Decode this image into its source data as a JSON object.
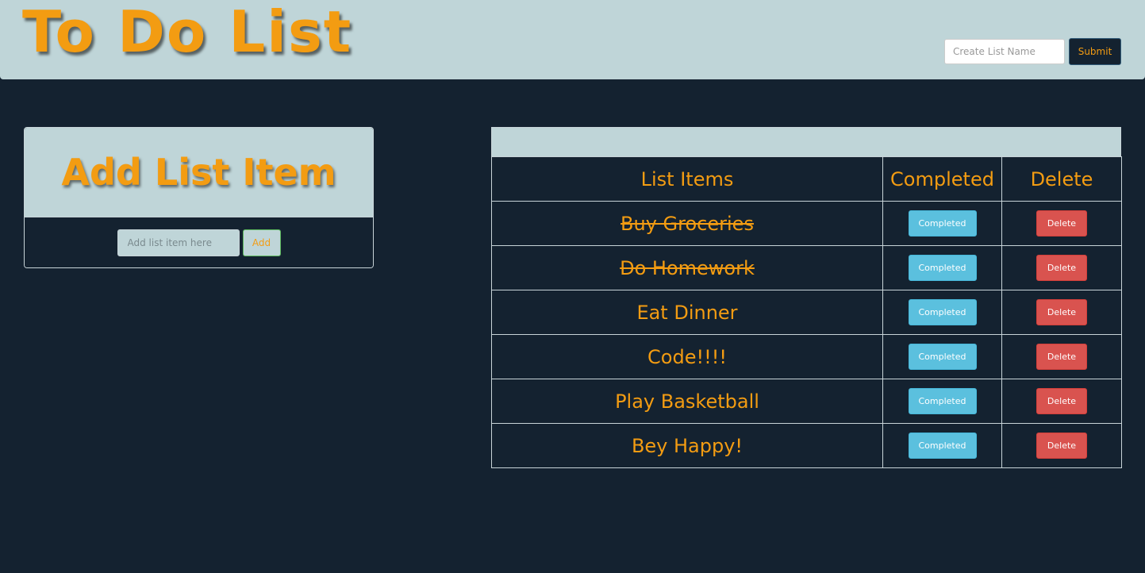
{
  "header": {
    "title": "To Do List",
    "list_name_placeholder": "Create List Name",
    "submit_label": "Submit"
  },
  "add_panel": {
    "title": "Add List Item",
    "input_placeholder": "Add list item here",
    "add_label": "Add"
  },
  "table": {
    "columns": [
      "List Items",
      "Completed",
      "Delete"
    ],
    "rows": [
      {
        "item": "Buy Groceries",
        "completed": true,
        "complete_label": "Completed",
        "delete_label": "Delete"
      },
      {
        "item": "Do Homework",
        "completed": true,
        "complete_label": "Completed",
        "delete_label": "Delete"
      },
      {
        "item": "Eat Dinner",
        "completed": false,
        "complete_label": "Completed",
        "delete_label": "Delete"
      },
      {
        "item": "Code!!!!",
        "completed": false,
        "complete_label": "Completed",
        "delete_label": "Delete"
      },
      {
        "item": "Play Basketball",
        "completed": false,
        "complete_label": "Completed",
        "delete_label": "Delete"
      },
      {
        "item": "Bey Happy!",
        "completed": false,
        "complete_label": "Completed",
        "delete_label": "Delete"
      }
    ]
  },
  "colors": {
    "background": "#142230",
    "panel": "#bfd5d8",
    "accent": "#f39c12",
    "info": "#5bc0de",
    "danger": "#d9534f"
  }
}
